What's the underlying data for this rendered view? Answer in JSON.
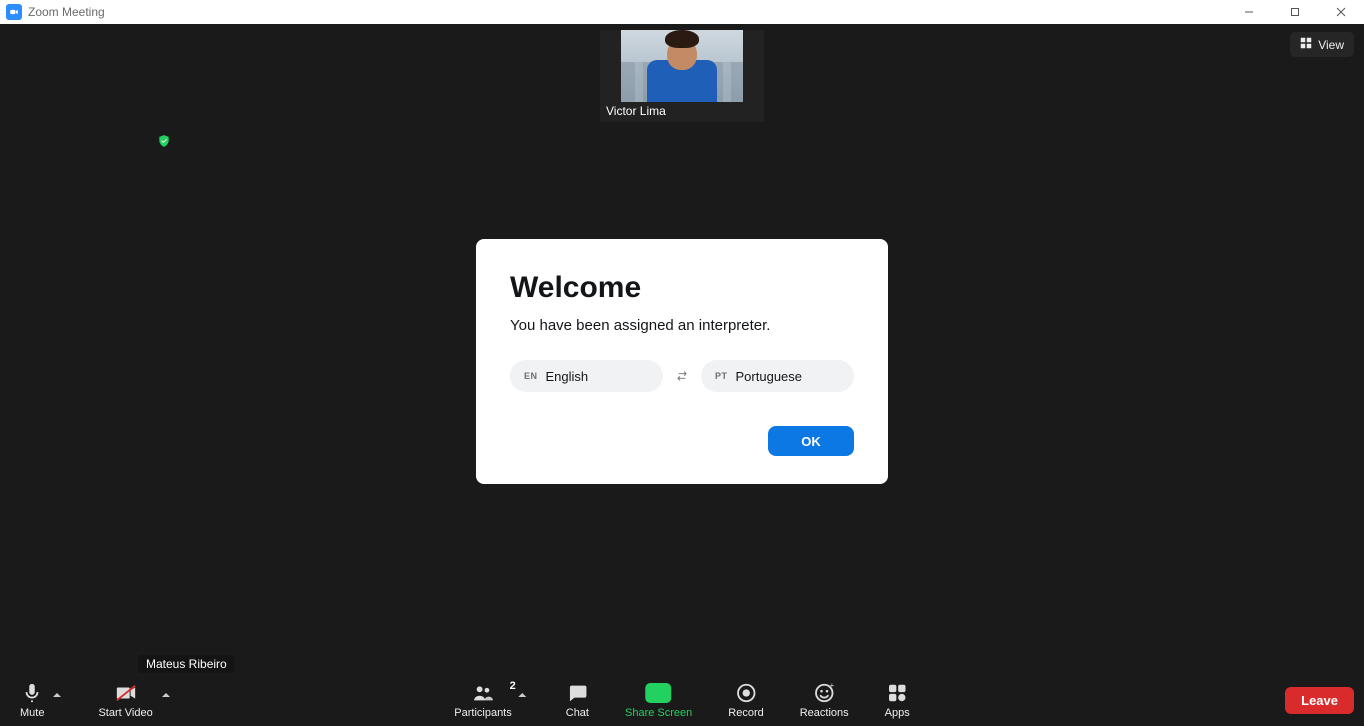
{
  "window": {
    "title": "Zoom Meeting"
  },
  "view_button": {
    "label": "View"
  },
  "remote_participant": {
    "name": "Victor Lima"
  },
  "self_participant": {
    "name": "Mateus Ribeiro"
  },
  "dialog": {
    "title": "Welcome",
    "subtitle": "You have been assigned an interpreter.",
    "language_from": {
      "code": "EN",
      "name": "English"
    },
    "language_to": {
      "code": "PT",
      "name": "Portuguese"
    },
    "ok_label": "OK"
  },
  "toolbar": {
    "mute": "Mute",
    "start_video": "Start Video",
    "participants": "Participants",
    "participants_count": "2",
    "chat": "Chat",
    "share_screen": "Share Screen",
    "record": "Record",
    "reactions": "Reactions",
    "apps": "Apps",
    "leave": "Leave"
  }
}
